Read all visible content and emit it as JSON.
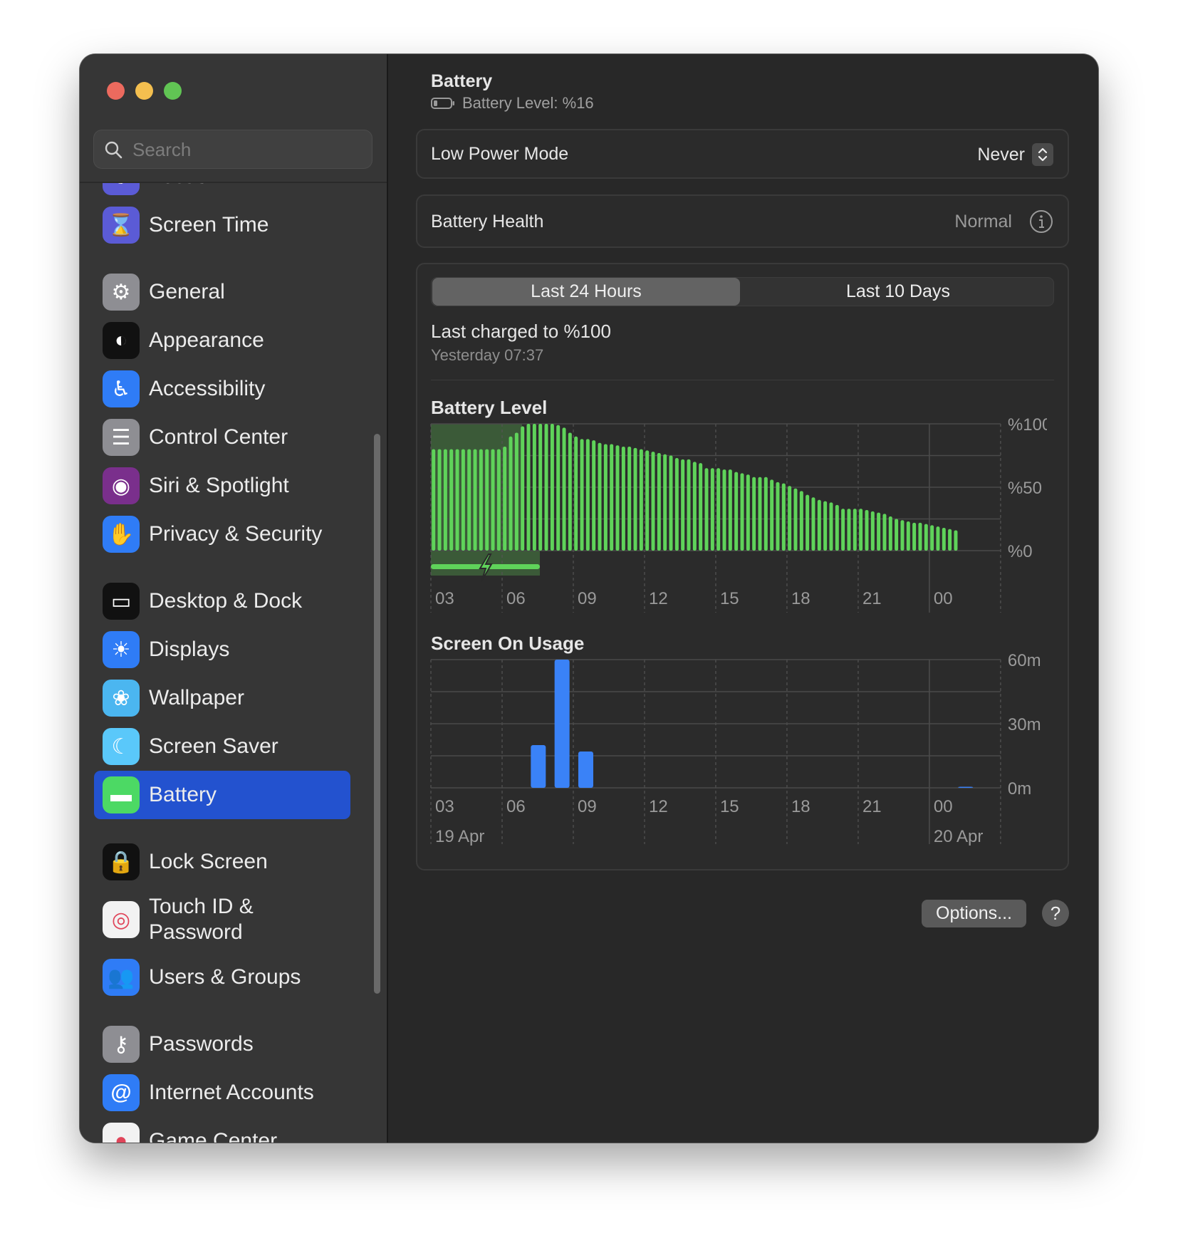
{
  "window": {
    "controls": [
      "close",
      "minimize",
      "zoom"
    ],
    "colors": {
      "close": "#ec6a5e",
      "minimize": "#f4bf4f",
      "zoom": "#61c554"
    }
  },
  "sidebar": {
    "search_placeholder": "Search",
    "items": [
      {
        "label": "Focus",
        "icon": "moon-icon",
        "color": "#5b5bd6",
        "glyph": "☾"
      },
      {
        "label": "Screen Time",
        "icon": "hourglass-icon",
        "color": "#5b5bd6",
        "glyph": "⌛"
      },
      {
        "label": "General",
        "icon": "gear-icon",
        "color": "#8e8e93",
        "glyph": "⚙"
      },
      {
        "label": "Appearance",
        "icon": "appearance-icon",
        "color": "#111111",
        "glyph": "◐"
      },
      {
        "label": "Accessibility",
        "icon": "accessibility-icon",
        "color": "#2f7cf6",
        "glyph": "♿"
      },
      {
        "label": "Control Center",
        "icon": "toggles-icon",
        "color": "#8e8e93",
        "glyph": "☰"
      },
      {
        "label": "Siri & Spotlight",
        "icon": "siri-icon",
        "color": "#7a2f8c",
        "glyph": "◉"
      },
      {
        "label": "Privacy & Security",
        "icon": "hand-icon",
        "color": "#2f7cf6",
        "glyph": "✋"
      },
      {
        "label": "Desktop & Dock",
        "icon": "dock-icon",
        "color": "#111111",
        "glyph": "▭"
      },
      {
        "label": "Displays",
        "icon": "sun-icon",
        "color": "#2f7cf6",
        "glyph": "☀"
      },
      {
        "label": "Wallpaper",
        "icon": "flower-icon",
        "color": "#4bb6f0",
        "glyph": "❀"
      },
      {
        "label": "Screen Saver",
        "icon": "screensaver-icon",
        "color": "#5ac8fa",
        "glyph": "☾"
      },
      {
        "label": "Battery",
        "icon": "battery-icon",
        "color": "#4cd964",
        "glyph": "▬"
      },
      {
        "label": "Lock Screen",
        "icon": "lock-icon",
        "color": "#111111",
        "glyph": "🔒"
      },
      {
        "label": "Touch ID & Password",
        "icon": "fingerprint-icon",
        "color": "#f2f2f2",
        "glyph": "◎"
      },
      {
        "label": "Users & Groups",
        "icon": "users-icon",
        "color": "#2f7cf6",
        "glyph": "👥"
      },
      {
        "label": "Passwords",
        "icon": "key-icon",
        "color": "#8e8e93",
        "glyph": "⚷"
      },
      {
        "label": "Internet Accounts",
        "icon": "at-icon",
        "color": "#2f7cf6",
        "glyph": "@"
      },
      {
        "label": "Game Center",
        "icon": "game-center-icon",
        "color": "#f2f2f2",
        "glyph": "●"
      }
    ],
    "selected": "Battery",
    "selection_color": "#2352cf"
  },
  "header": {
    "title": "Battery",
    "subtitle": "Battery Level: %16"
  },
  "low_power": {
    "label": "Low Power Mode",
    "value": "Never"
  },
  "health": {
    "label": "Battery Health",
    "value": "Normal"
  },
  "tabs": [
    {
      "label": "Last 24 Hours",
      "active": true
    },
    {
      "label": "Last 10 Days",
      "active": false
    }
  ],
  "last_charged": {
    "title": "Last charged to %100",
    "time": "Yesterday 07:37"
  },
  "buttons": {
    "options": "Options...",
    "help": "?"
  },
  "chart_data": [
    {
      "type": "bar",
      "title": "Battery Level",
      "x_interval_minutes": 15,
      "x_start": "03:00",
      "x_ticks": [
        "03",
        "06",
        "09",
        "12",
        "15",
        "18",
        "21",
        "00"
      ],
      "y_ticks": [
        "%100",
        "%50",
        "%0"
      ],
      "ylim": [
        0,
        100
      ],
      "grid": true,
      "color": "#5fd35a",
      "charging_period": {
        "start": "03:00",
        "end": "07:37"
      },
      "values": [
        80,
        80,
        80,
        80,
        80,
        80,
        80,
        80,
        80,
        80,
        80,
        80,
        82,
        90,
        93,
        98,
        100,
        100,
        100,
        100,
        100,
        99,
        97,
        93,
        90,
        88,
        88,
        87,
        85,
        84,
        84,
        83,
        82,
        82,
        81,
        80,
        79,
        78,
        77,
        76,
        75,
        73,
        72,
        72,
        70,
        69,
        65,
        65,
        65,
        64,
        64,
        62,
        61,
        60,
        58,
        58,
        58,
        56,
        54,
        53,
        51,
        49,
        47,
        44,
        42,
        40,
        39,
        38,
        36,
        33,
        33,
        33,
        33,
        32,
        31,
        30,
        29,
        27,
        25,
        24,
        23,
        22,
        22,
        21,
        20,
        19,
        18,
        17,
        16
      ]
    },
    {
      "type": "bar",
      "title": "Screen On Usage",
      "x_ticks": [
        "03",
        "06",
        "09",
        "12",
        "15",
        "18",
        "21",
        "00"
      ],
      "date_labels": [
        "19 Apr",
        "20 Apr"
      ],
      "y_ticks": [
        "60m",
        "30m",
        "0m"
      ],
      "ylim": [
        0,
        60
      ],
      "grid": true,
      "color": "#3a82f7",
      "categories": [
        "07",
        "08",
        "09",
        "01"
      ],
      "values": [
        20,
        60,
        17,
        0.3
      ]
    }
  ]
}
